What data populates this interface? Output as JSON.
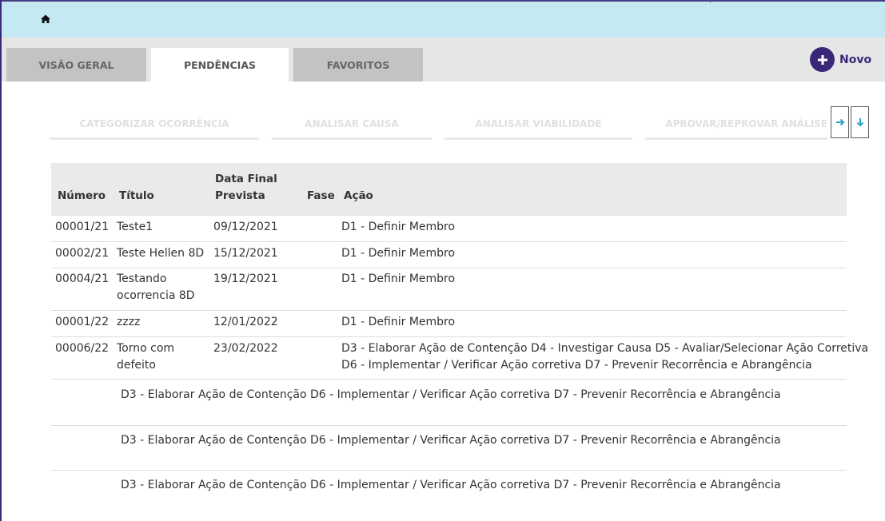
{
  "header": {
    "home_icon": "home-icon"
  },
  "tabs": [
    {
      "label": "VISÃO GERAL",
      "active": false
    },
    {
      "label": "PENDÊNCIAS",
      "active": true
    },
    {
      "label": "FAVORITOS",
      "active": false
    }
  ],
  "new_button": {
    "icon": "plus-icon",
    "label": "Novo"
  },
  "steps": [
    "CATEGORIZAR OCORRÊNCIA",
    "ANALISAR CAUSA",
    "ANALISAR VIABILIDADE",
    "APROVAR/REPROVAR ANÁLISE"
  ],
  "nav": {
    "next_icon": "arrow-right-icon",
    "down_icon": "arrow-down-icon"
  },
  "table": {
    "columns": {
      "numero": "Número",
      "titulo": "Título",
      "data_1": "Data Final",
      "data_2": "Prevista",
      "fase": "Fase",
      "acao": "Ação"
    },
    "rows": [
      {
        "numero": "00001/21",
        "titulo_1": "Teste1",
        "titulo_2": "",
        "data": "09/12/2021",
        "acao_1": "D1 - Definir Membro",
        "acao_2": ""
      },
      {
        "numero": "00002/21",
        "titulo_1": "Teste Hellen 8D",
        "titulo_2": "",
        "data": "15/12/2021",
        "acao_1": "D1 - Definir Membro",
        "acao_2": ""
      },
      {
        "numero": "00004/21",
        "titulo_1": "Testando",
        "titulo_2": "ocorrencia 8D",
        "data": "19/12/2021",
        "acao_1": "D1 - Definir Membro",
        "acao_2": ""
      },
      {
        "numero": "00001/22",
        "titulo_1": "zzzz",
        "titulo_2": "",
        "data": "12/01/2022",
        "acao_1": "D1 - Definir Membro",
        "acao_2": ""
      },
      {
        "numero": "00006/22",
        "titulo_1": "Torno com",
        "titulo_2": "defeito",
        "data": "23/02/2022",
        "acao_1": "D3 - Elaborar Ação de Contenção D4 - Investigar Causa D5 - Avaliar/Selecionar Ação Corretiva",
        "acao_2": "D6 - Implementar / Verificar Ação corretiva D7 - Prevenir Recorrência e Abrangência"
      }
    ],
    "sub_rows": [
      "D3 - Elaborar Ação de Contenção D6 - Implementar / Verificar Ação corretiva D7 - Prevenir Recorrência e Abrangência",
      "D3 - Elaborar Ação de Contenção D6 - Implementar / Verificar Ação corretiva D7 - Prevenir Recorrência e Abrangência",
      "D3 - Elaborar Ação de Contenção D6 - Implementar / Verificar Ação corretiva D7 - Prevenir Recorrência e Abrangência"
    ]
  }
}
